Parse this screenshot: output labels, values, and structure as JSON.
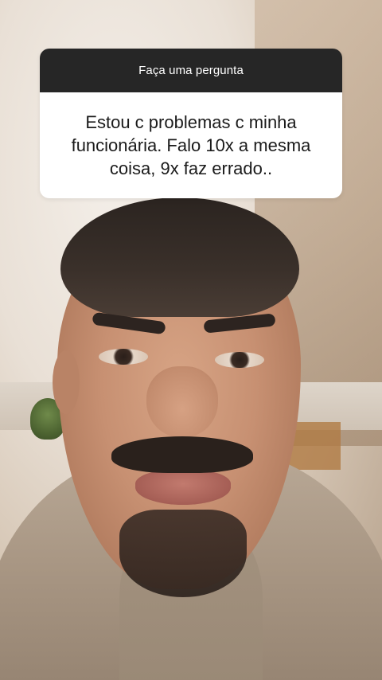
{
  "question_sticker": {
    "header": "Faça uma pergunta",
    "lines": [
      "Estou c problemas c minha",
      "funcionária. Falo 10x a mesma",
      "coisa, 9x faz errado.."
    ],
    "colors": {
      "header_bg": "#262626",
      "header_text": "#ffffff",
      "body_bg": "#ffffff",
      "body_text": "#1b1b1b"
    }
  },
  "background": {
    "type": "video-frame",
    "subject": "person-face-closeup"
  }
}
